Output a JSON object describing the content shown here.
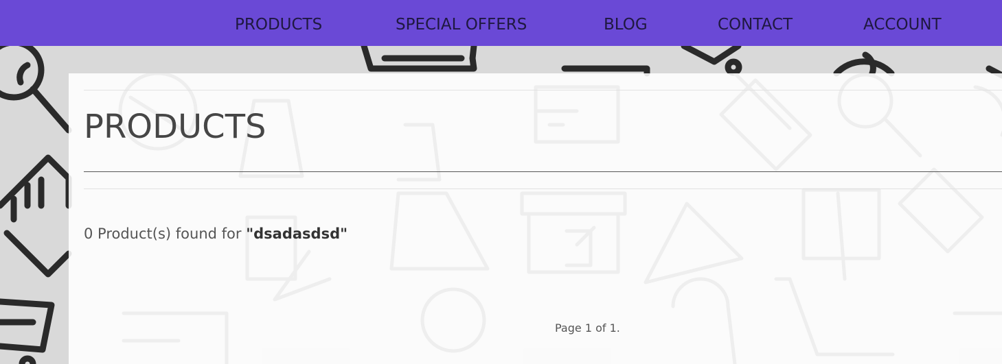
{
  "nav": {
    "items": [
      {
        "label": "PRODUCTS"
      },
      {
        "label": "SPECIAL OFFERS"
      },
      {
        "label": "BLOG"
      },
      {
        "label": "CONTACT"
      },
      {
        "label": "ACCOUNT"
      }
    ]
  },
  "main": {
    "title": "PRODUCTS",
    "result_prefix": "0 Product(s) found for ",
    "result_query": "\"dsadasdsd\"",
    "pagination": "Page 1 of 1."
  },
  "colors": {
    "nav_background": "#6a49d6",
    "nav_text": "#1f1840",
    "panel_background": "#ffffff",
    "text": "#555555"
  },
  "icons": [
    "magnifier-icon",
    "shopping-cart-icon",
    "credit-card-icon",
    "price-tag-icon",
    "laptop-icon",
    "shopping-bag-icon",
    "hanger-icon",
    "gift-icon",
    "store-icon",
    "percent-icon"
  ]
}
